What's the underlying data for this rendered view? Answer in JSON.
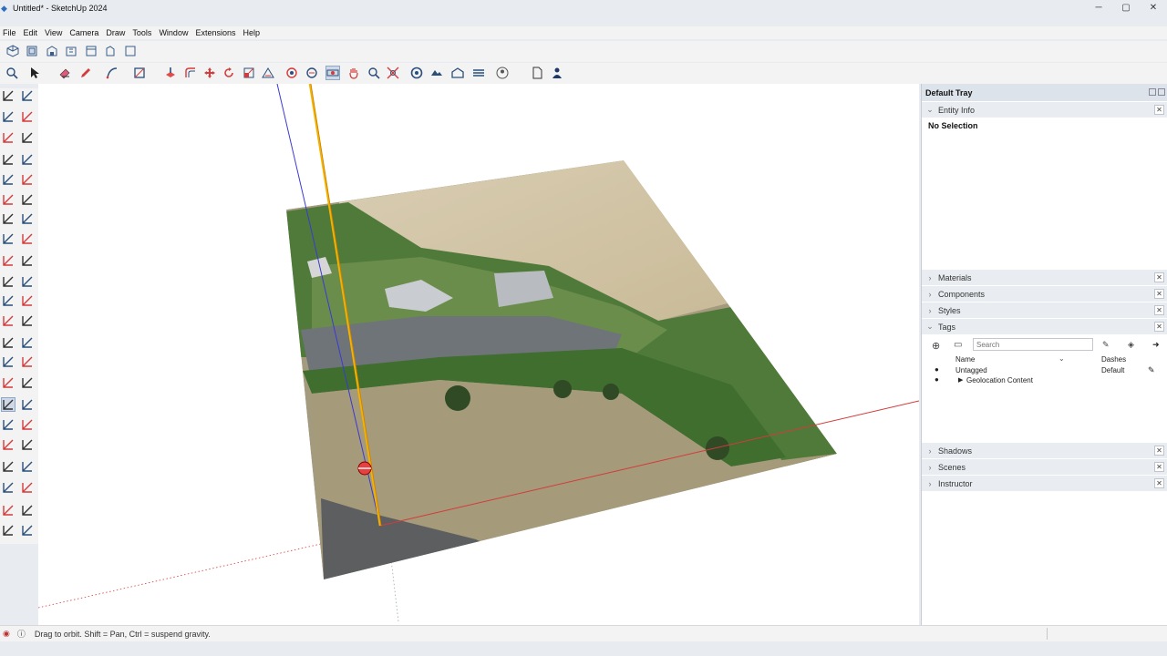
{
  "window": {
    "title": "Untitled* - SketchUp 2024",
    "min": "─",
    "max": "▢",
    "close": "✕"
  },
  "menu": [
    "File",
    "Edit",
    "View",
    "Camera",
    "Draw",
    "Tools",
    "Window",
    "Extensions",
    "Help"
  ],
  "toolbar_top": [
    "iso-view-icon",
    "top-view-icon",
    "front-view-icon",
    "right-view-icon",
    "back-view-icon",
    "left-view-icon",
    "bottom-view-icon"
  ],
  "toolbar_main": [
    "zoom-icon",
    "select-icon",
    "eraser-icon",
    "pencil-icon",
    "arc-icon",
    "rectangle-icon",
    "push-pull-icon",
    "offset-icon",
    "move-icon",
    "rotate-icon",
    "scale-icon",
    "follow-me-icon",
    "section-icon",
    "section-plane-icon",
    "orbit-icon",
    "pan-icon",
    "zoom-icon-2",
    "zoom-extents-icon",
    "geolocation-icon",
    "terrain-icon",
    "3d-warehouse-icon",
    "extension-warehouse-icon",
    "user-icon",
    "document-icon",
    "profile-icon"
  ],
  "tray": {
    "title": "Default Tray",
    "entity_info": {
      "label": "Entity Info",
      "selection": "No Selection"
    },
    "panels": [
      "Materials",
      "Components",
      "Styles"
    ],
    "tags": {
      "label": "Tags",
      "search_placeholder": "Search",
      "col_name": "Name",
      "col_dashes": "Dashes",
      "rows": [
        {
          "name": "Untagged",
          "dashes": "Default"
        },
        {
          "name": "Geolocation Content",
          "dashes": ""
        }
      ]
    },
    "lower_panels": [
      "Shadows",
      "Scenes",
      "Instructor"
    ]
  },
  "status": {
    "hint": "Drag to orbit. Shift = Pan, Ctrl = suspend gravity."
  },
  "colors": {
    "red_axis": "#d43b3b",
    "green_axis": "#2f8f2f",
    "blue_axis": "#3a3ad4",
    "selection_yellow": "#f0b400"
  }
}
